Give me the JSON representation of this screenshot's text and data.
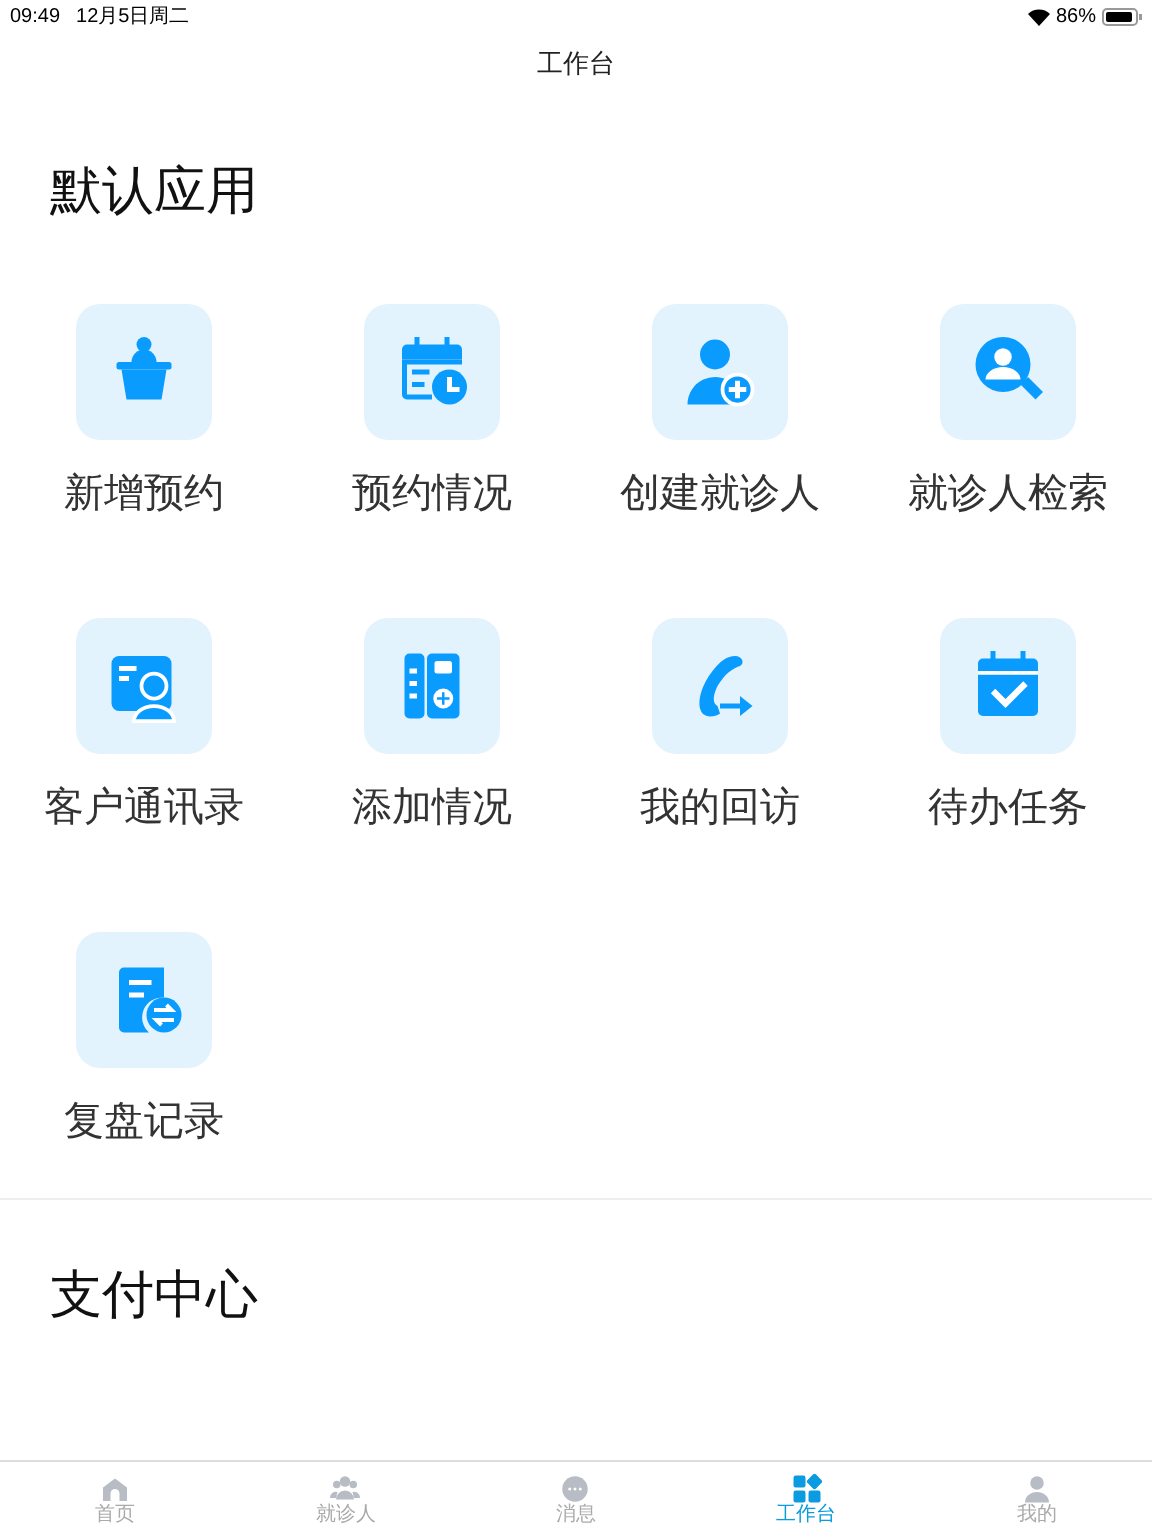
{
  "status_bar": {
    "time": "09:49",
    "date": "12月5日周二",
    "battery": "86%"
  },
  "nav_bar": {
    "title": "工作台"
  },
  "default_apps": {
    "title": "默认应用",
    "items": [
      {
        "label": "新增预约"
      },
      {
        "label": "预约情况"
      },
      {
        "label": "创建就诊人"
      },
      {
        "label": "就诊人检索"
      },
      {
        "label": "客户通讯录"
      },
      {
        "label": "添加情况"
      },
      {
        "label": "我的回访"
      },
      {
        "label": "待办任务"
      },
      {
        "label": "复盘记录"
      }
    ]
  },
  "payment_center": {
    "title": "支付中心"
  },
  "tab_bar": [
    {
      "label": "首页",
      "selected": false
    },
    {
      "label": "就诊人",
      "selected": false
    },
    {
      "label": "消息",
      "selected": false
    },
    {
      "label": "工作台",
      "selected": true
    },
    {
      "label": "我的",
      "selected": false
    }
  ]
}
